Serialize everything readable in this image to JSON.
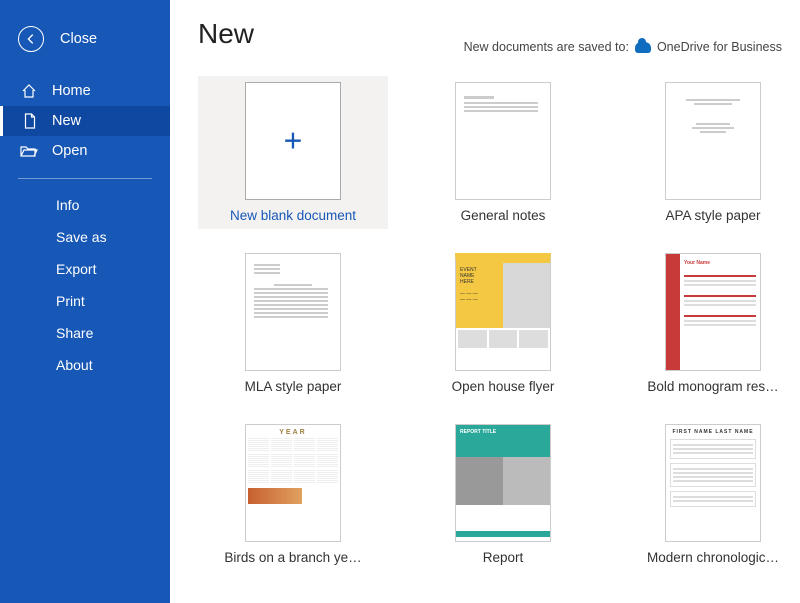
{
  "close_label": "Close",
  "sidebar": {
    "nav": [
      {
        "label": "Home",
        "icon": "home-icon"
      },
      {
        "label": "New",
        "icon": "file-icon",
        "selected": true
      },
      {
        "label": "Open",
        "icon": "folder-icon"
      }
    ],
    "sub": [
      "Info",
      "Save as",
      "Export",
      "Print",
      "Share",
      "About"
    ]
  },
  "page_title": "New",
  "saved_notice_prefix": "New documents are saved to:",
  "saved_notice_location": "OneDrive for Business",
  "templates": [
    {
      "label": "New blank document",
      "highlight": true,
      "thumb": "blank"
    },
    {
      "label": "General notes",
      "highlight": false,
      "thumb": "notes"
    },
    {
      "label": "APA style paper",
      "highlight": false,
      "thumb": "apa"
    },
    {
      "label": "MLA style paper",
      "highlight": false,
      "thumb": "mla"
    },
    {
      "label": "Open house flyer",
      "highlight": false,
      "thumb": "openhouse"
    },
    {
      "label": "Bold monogram res…",
      "highlight": false,
      "thumb": "boldresume"
    },
    {
      "label": "Birds on a branch ye…",
      "highlight": false,
      "thumb": "calendar"
    },
    {
      "label": "Report",
      "highlight": false,
      "thumb": "report"
    },
    {
      "label": "Modern chronologic…",
      "highlight": false,
      "thumb": "chron"
    }
  ]
}
